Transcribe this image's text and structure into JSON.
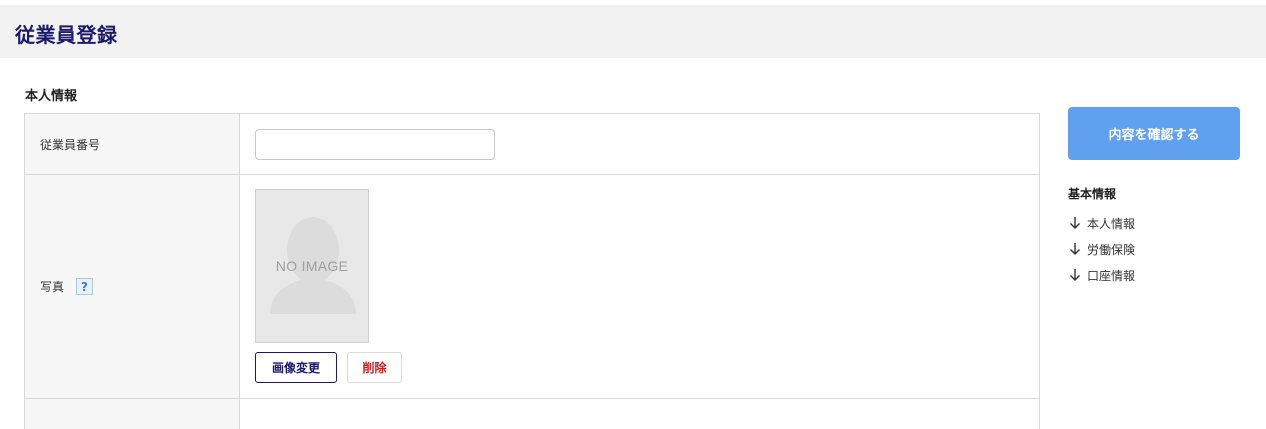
{
  "header": {
    "title": "従業員登録"
  },
  "section": {
    "title": "本人情報"
  },
  "form": {
    "employee_number": {
      "label": "従業員番号",
      "value": "",
      "placeholder": ""
    },
    "photo": {
      "label": "写真",
      "help": "?",
      "no_image": "NO IMAGE",
      "change_button": "画像変更",
      "delete_button": "削除"
    }
  },
  "sidebar": {
    "confirm_button": "内容を確認する",
    "nav_title": "基本情報",
    "nav_items": [
      {
        "label": "本人情報",
        "icon": "arrow-down-icon"
      },
      {
        "label": "労働保険",
        "icon": "arrow-down-icon"
      },
      {
        "label": "口座情報",
        "icon": "arrow-down-icon"
      }
    ]
  },
  "colors": {
    "title": "#1d1a6e",
    "confirm_button": "#5fa0ef",
    "delete_text": "#d01c1c",
    "header_bg": "#f2f2f2"
  }
}
